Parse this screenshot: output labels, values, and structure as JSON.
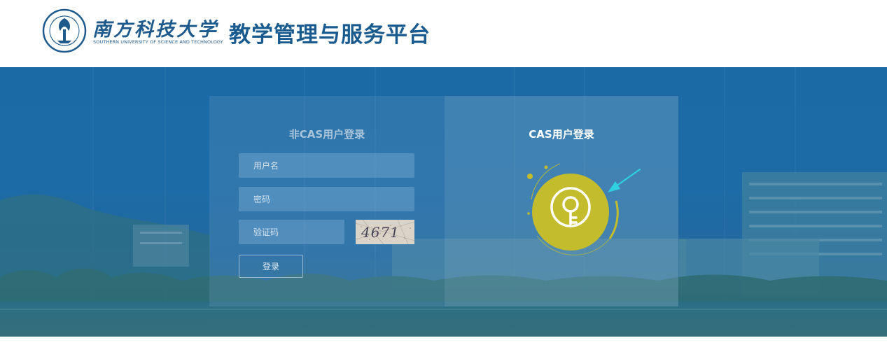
{
  "header": {
    "university_name_cn": "南方科技大学",
    "university_name_en": "SOUTHERN UNIVERSITY OF SCIENCE AND TECHNOLOGY",
    "platform_title": "教学管理与服务平台",
    "logo_icon": "university-seal-icon"
  },
  "non_cas_login": {
    "title": "非CAS用户登录",
    "username_placeholder": "用户名",
    "password_placeholder": "密码",
    "captcha_placeholder": "验证码",
    "captcha_text": "4671",
    "login_button": "登录"
  },
  "cas_login": {
    "title": "CAS用户登录",
    "icon": "key-icon",
    "pointer_icon": "arrow-icon"
  },
  "colors": {
    "brand_blue": "#1a5b8f",
    "hero_blue": "#1b6aa5",
    "cas_button": "#c3bc2c",
    "arrow_cyan": "#2fd0e0"
  }
}
